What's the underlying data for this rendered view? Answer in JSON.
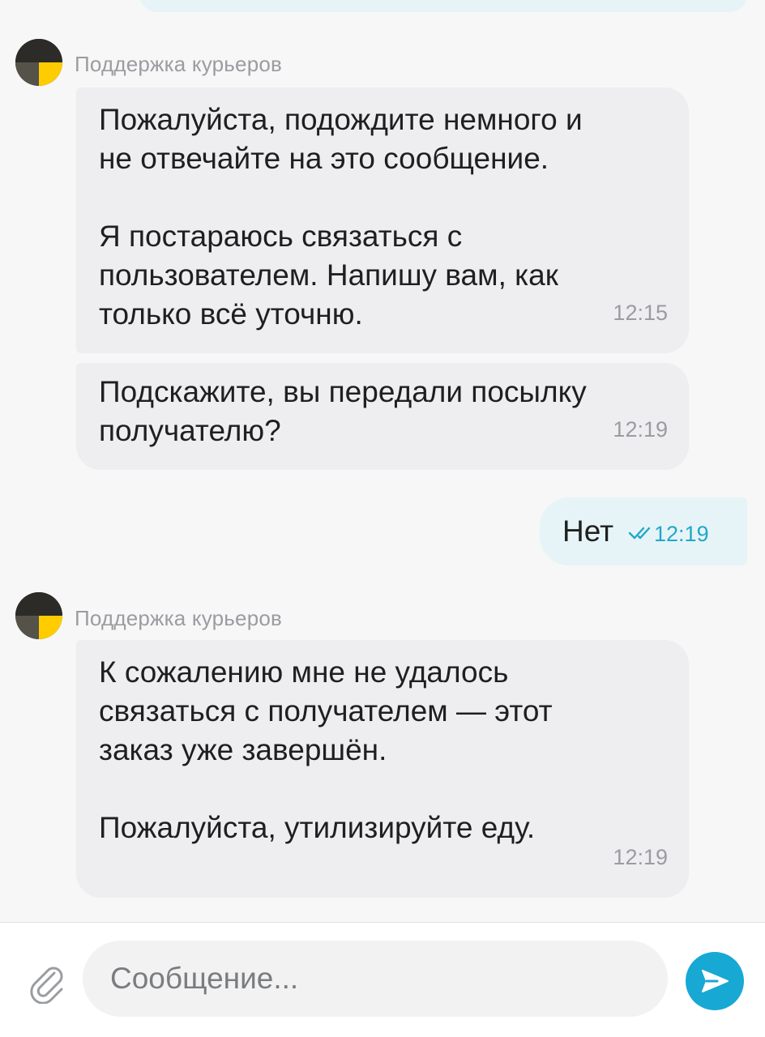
{
  "messages": [
    {
      "sender": "Поддержка курьеров",
      "text": "Пожалуйста, подождите немного и\nне отвечайте на это сообщение.\n\nЯ постараюсь связаться с\nпользователем. Напишу вам, как\nтолько всё уточню.",
      "time": "12:15"
    },
    {
      "text": "Подскажите, вы передали посылку\nполучателю?",
      "time": "12:19"
    },
    {
      "text": "Нет",
      "time": "12:19",
      "status_icon": "double-check-icon"
    },
    {
      "sender": "Поддержка курьеров",
      "text": "К сожалению мне не удалось\nсвязаться с получателем — этот\nзаказ уже завершён.\n\nПожалуйста, утилизируйте еду.",
      "time": "12:19"
    }
  ],
  "composer": {
    "placeholder": "Сообщение...",
    "attach_icon": "paperclip-icon",
    "send_icon": "send-arrow-icon"
  },
  "colors": {
    "background": "#f7f7f8",
    "incoming_bubble": "#eeeef0",
    "outgoing_bubble": "#e6f4f7",
    "accent": "#17a8d4",
    "avatar_yellow": "#ffcc00"
  }
}
